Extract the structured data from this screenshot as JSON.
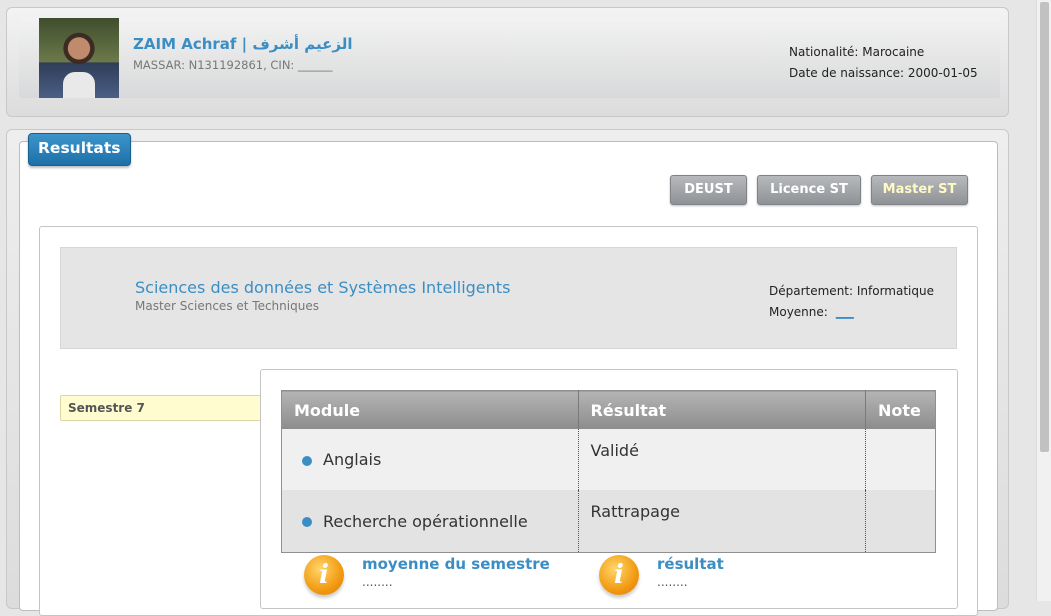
{
  "profile": {
    "name": "ZAIM Achraf  |  الزعيم أشرف",
    "ids": "MASSAR: N131192861, CIN: ______",
    "nationality": "Nationalité: Marocaine",
    "birthdate": "Date de naissance: 2000-01-05"
  },
  "results_tab": "Resultats",
  "levels": {
    "deust": "DEUST",
    "licence": "Licence ST",
    "master": "Master ST"
  },
  "program": {
    "title": "Sciences des données et Systèmes Intelligents",
    "subtitle": "Master Sciences et Techniques",
    "department": "Département: Informatique",
    "moyenne_label": "Moyenne:",
    "moyenne_value": "___"
  },
  "semester": {
    "label": "Semestre 7"
  },
  "table": {
    "headers": {
      "module": "Module",
      "resultat": "Résultat",
      "note": "Note"
    },
    "rows": [
      {
        "module": "Anglais",
        "resultat": "Validé",
        "note": ""
      },
      {
        "module": "Recherche opérationnelle",
        "resultat": "Rattrapage",
        "note": ""
      }
    ]
  },
  "summary": {
    "moyenne": {
      "icon": "info-icon",
      "title": "moyenne du semestre",
      "value": "........"
    },
    "resultat": {
      "icon": "info-icon",
      "title": "résultat",
      "value": "........"
    }
  },
  "colors": {
    "accent_blue": "#3b8ec4",
    "tab_blue": "#1d70a8",
    "button_gray": "#9fa2a6",
    "semester_highlight": "#fffdd0",
    "info_orange": "#f29a12"
  }
}
